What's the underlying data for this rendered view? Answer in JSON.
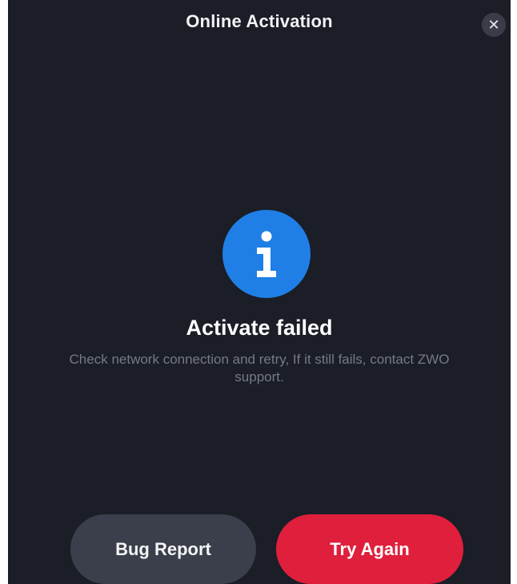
{
  "dialog": {
    "title": "Online Activation",
    "close_symbol": "✕",
    "status_icon": "info-icon",
    "heading": "Activate failed",
    "message": "Check network connection and retry, If it still fails, contact ZWO support."
  },
  "actions": {
    "bug_report_label": "Bug Report",
    "try_again_label": "Try Again"
  },
  "colors": {
    "background": "#1b1d27",
    "info_blue": "#1f7fe6",
    "primary_red": "#df1f3c",
    "secondary_gray": "#3a3f4b"
  }
}
